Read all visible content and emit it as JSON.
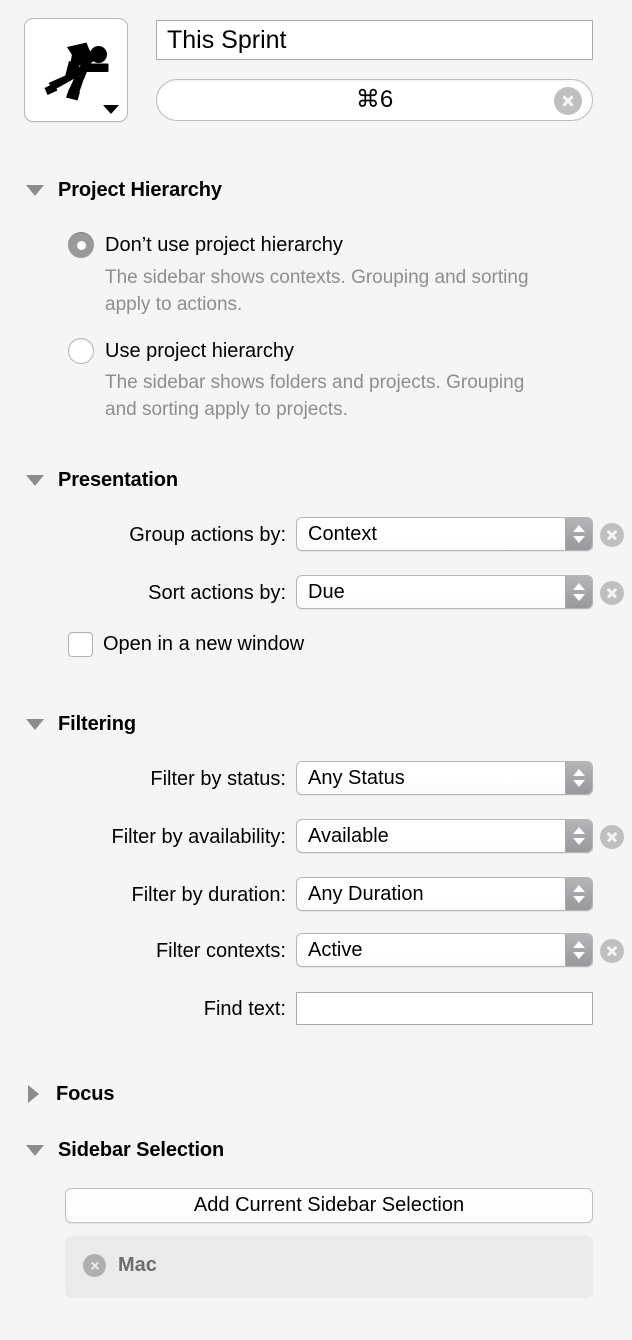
{
  "header": {
    "icon_name": "runner-icon",
    "icon_popup_name": "icon-chooser-disclosure",
    "perspective_name": "This Sprint",
    "perspective_name_placeholder": "Name",
    "shortcut": "⌘6",
    "shortcut_clear_label": "clear-shortcut"
  },
  "sections": {
    "project_hierarchy": {
      "title": "Project Hierarchy",
      "expanded": true,
      "options": [
        {
          "label": "Don’t use project hierarchy",
          "description": "The sidebar shows contexts. Grouping and sorting apply to actions.",
          "selected": true
        },
        {
          "label": "Use project hierarchy",
          "description": "The sidebar shows folders and projects. Grouping and sorting apply to projects.",
          "selected": false
        }
      ]
    },
    "presentation": {
      "title": "Presentation",
      "expanded": true,
      "rows": [
        {
          "label": "Group actions by:",
          "value": "Context",
          "has_clear": true
        },
        {
          "label": "Sort actions by:",
          "value": "Due",
          "has_clear": true
        }
      ],
      "checkbox": {
        "label": "Open in a new window",
        "checked": false
      }
    },
    "filtering": {
      "title": "Filtering",
      "expanded": true,
      "rows": [
        {
          "label": "Filter by status:",
          "value": "Any Status",
          "has_clear": false
        },
        {
          "label": "Filter by availability:",
          "value": "Available",
          "has_clear": true
        },
        {
          "label": "Filter by duration:",
          "value": "Any Duration",
          "has_clear": false
        },
        {
          "label": "Filter contexts:",
          "value": "Active",
          "has_clear": true
        }
      ],
      "find_text": {
        "label": "Find text:",
        "value": "",
        "placeholder": ""
      }
    },
    "focus": {
      "title": "Focus",
      "expanded": false
    },
    "sidebar_selection": {
      "title": "Sidebar Selection",
      "expanded": true,
      "add_button_label": "Add Current Sidebar Selection",
      "items": [
        {
          "label": "Mac",
          "remove_label": "remove-Mac"
        }
      ]
    }
  },
  "colors": {
    "window_background": "#f5f5f5",
    "field_background": "#ffffff",
    "muted_text": "#8e8e8e",
    "stepper_gray": "#97979c",
    "clear_button_gray": "#bfbfbf",
    "selection_list_background": "#eaeaea",
    "disclosure_gray": "#8c8c8c"
  }
}
